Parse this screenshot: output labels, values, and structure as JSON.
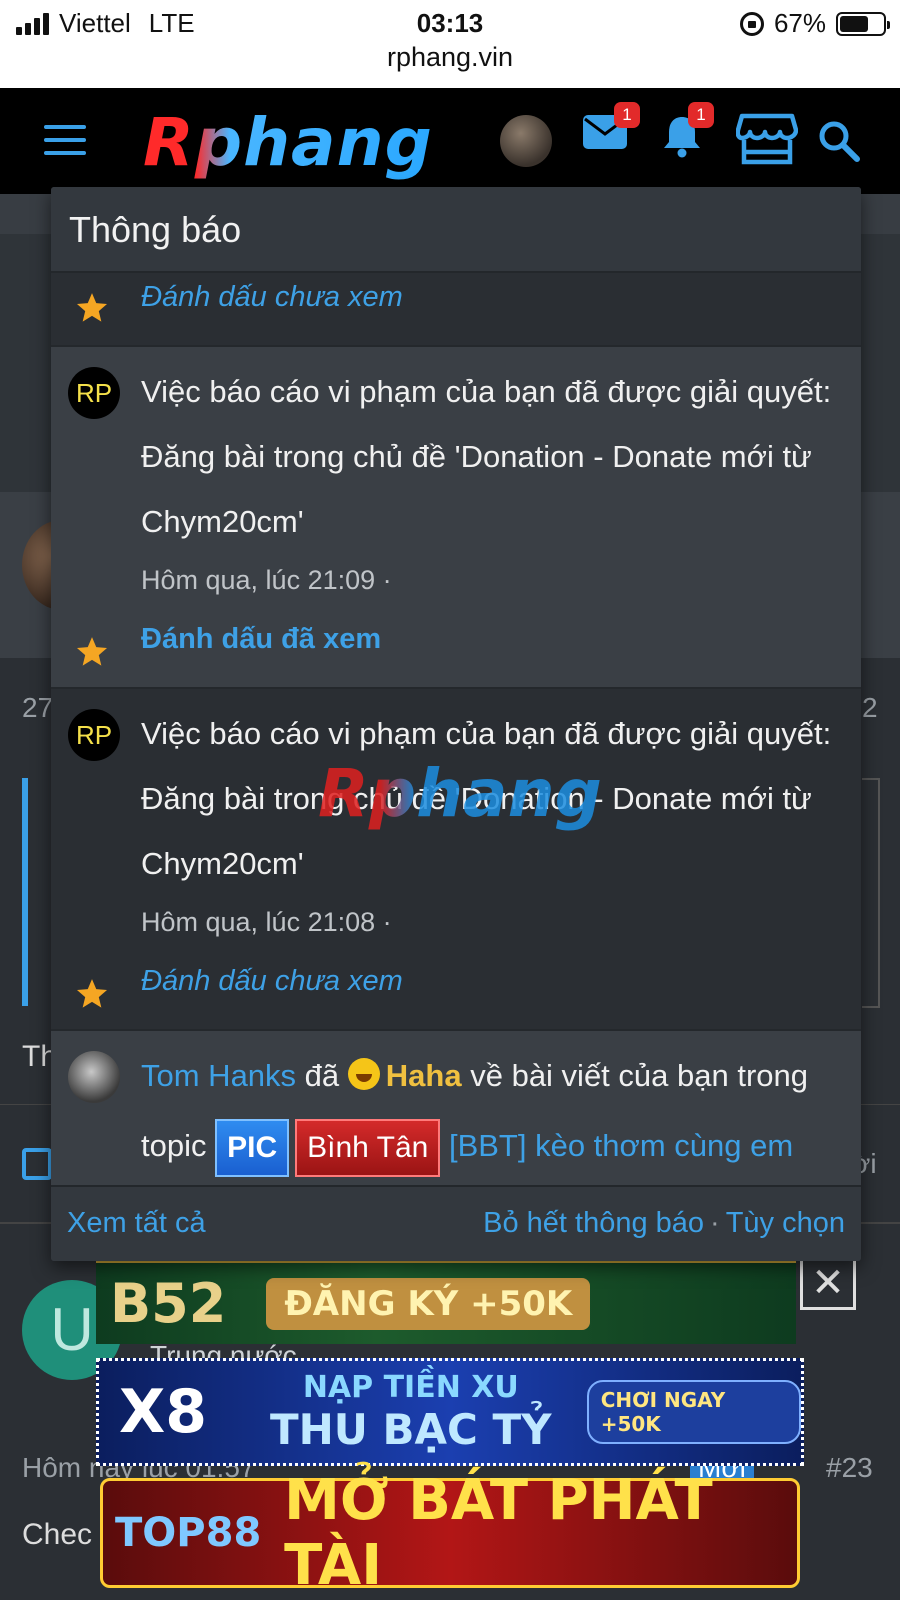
{
  "status_bar": {
    "carrier": "Viettel",
    "network": "LTE",
    "time": "03:13",
    "url": "rphang.vin",
    "battery": "67%",
    "battery_level": 0.67
  },
  "nav": {
    "logo": "Rphang",
    "messages_badge": "1",
    "alerts_badge": "1",
    "accent_color": "#3aa0e8"
  },
  "background": {
    "post_count_left": "27",
    "post_count_right": "2",
    "text_th": "Th",
    "text_oi": "ời",
    "user_initial": "U",
    "user_subtitle": "Trung nước",
    "post_time": "Hôm nay lúc 01:57",
    "post_new": "Mới",
    "post_number": "#23",
    "post_snippet": "Chec"
  },
  "ads": {
    "b52_brand": "B52",
    "b52_cta": "ĐĂNG KÝ +50K",
    "x8_brand": "X8",
    "x8_line1": "NẠP TIỀN XU",
    "x8_line2": "THU BẠC TỶ",
    "x8_cta": "CHƠI NGAY +50K",
    "top88_brand": "TOP88",
    "top88_slogan": "MỞ BÁT PHÁT TÀI",
    "close": "✕"
  },
  "popup": {
    "title": "Thông báo",
    "notifications": [
      {
        "mark_label": "Đánh dấu chưa xem"
      },
      {
        "avatar": "RP",
        "text": "Việc báo cáo vi phạm của bạn đã được giải quyết: Đăng bài trong chủ đề 'Donation - Donate mới từ Chym20cm'",
        "time": "Hôm qua, lúc 21:09 ·",
        "mark_label": "Đánh dấu đã xem"
      },
      {
        "avatar": "RP",
        "text": "Việc báo cáo vi phạm của bạn đã được giải quyết: Đăng bài trong chủ đề 'Donation - Donate mới từ Chym20cm'",
        "time": "Hôm qua, lúc 21:08 ·",
        "mark_label": "Đánh dấu chưa xem"
      },
      {
        "user": "Tom Hanks",
        "verb": "đã",
        "reaction": "Haha",
        "text_after": "về bài viết của bạn trong",
        "topic_word": "topic",
        "tag1": "PIC",
        "tag2": "Bình Tân",
        "thread": "[BBT] kèo thơm cùng em"
      }
    ],
    "footer": {
      "view_all": "Xem tất cả",
      "dismiss_all": "Bỏ hết thông báo",
      "separator": "·",
      "options": "Tùy chọn"
    }
  },
  "watermark": "Rphang"
}
